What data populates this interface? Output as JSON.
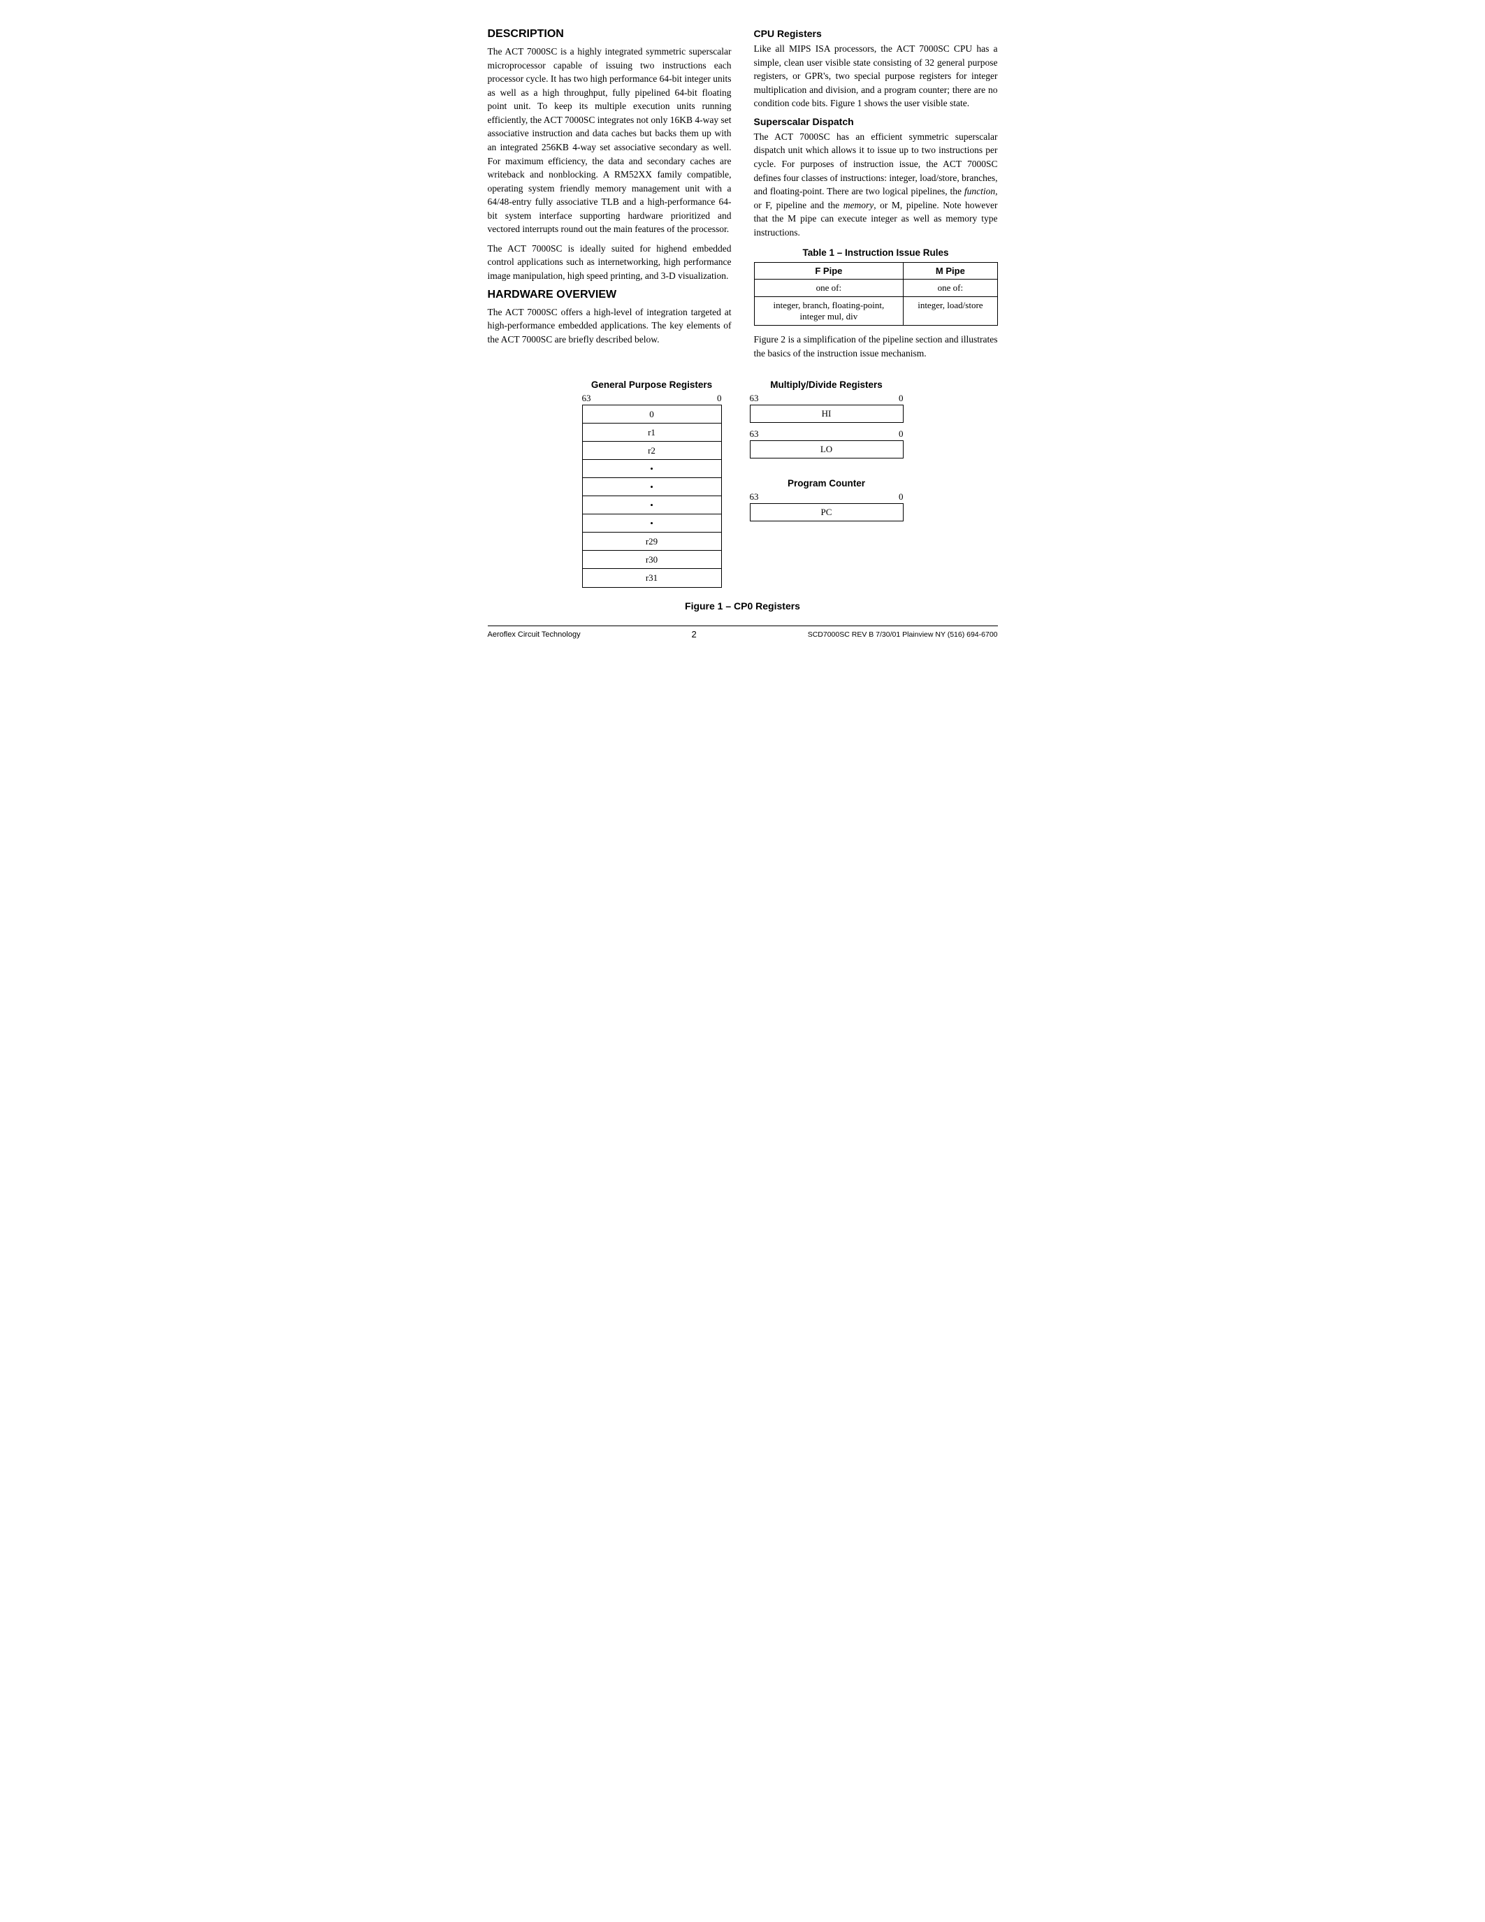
{
  "page": {
    "sections": {
      "description": {
        "heading": "DESCRIPTION",
        "paragraphs": [
          "The ACT 7000SC is a highly integrated symmetric superscalar microprocessor capable of issuing two instructions each processor cycle. It has two high performance 64-bit integer units as well as a high throughput, fully pipelined 64-bit floating point unit. To keep its multiple execution units running efficiently, the ACT 7000SC integrates not only 16KB 4-way set associative instruction and data caches but backs them up with an integrated 256KB 4-way set associative secondary as well. For maximum efficiency, the data and secondary caches are writeback and nonblocking. A RM52XX family compatible, operating system friendly memory management unit with a 64/48-entry fully associative TLB and a high-performance 64-bit system interface supporting hardware prioritized and vectored interrupts round out the main features of the processor.",
          "The ACT 7000SC is ideally suited for highend embedded control applications such as internetworking, high performance image manipulation, high speed printing, and 3-D visualization."
        ]
      },
      "hardware_overview": {
        "heading": "HARDWARE OVERVIEW",
        "paragraphs": [
          "The ACT 7000SC offers a high-level of integration targeted at high-performance embedded applications. The key elements of the ACT 7000SC are briefly described below."
        ]
      },
      "cpu_registers": {
        "heading": "CPU Registers",
        "paragraphs": [
          "Like all MIPS ISA processors, the ACT 7000SC CPU has a simple, clean user visible state consisting of 32 general purpose registers, or GPR's, two special purpose registers for integer multiplication and division, and a program counter; there are no condition code bits. Figure 1 shows the user visible state."
        ]
      },
      "superscalar_dispatch": {
        "heading": "Superscalar Dispatch",
        "paragraphs": [
          "The ACT 7000SC has an efficient symmetric superscalar dispatch unit which allows it to issue up to two instructions per cycle. For purposes of instruction issue, the ACT 7000SC defines four classes of instructions: integer, load/store, branches, and floating-point. There are two logical pipelines, the function, or F, pipeline and the memory, or M, pipeline. Note however that the M pipe can execute integer as well as memory type instructions.",
          "Figure 2 is a simplification of the pipeline section and illustrates the basics of the instruction issue mechanism."
        ]
      },
      "table1": {
        "title": "Table 1 – Instruction Issue Rules",
        "columns": [
          "F Pipe",
          "M Pipe"
        ],
        "rows": [
          [
            "one of:",
            "one of:"
          ],
          [
            "integer, branch, floating-point,\ninteger mul, div",
            "integer, load/store"
          ]
        ]
      }
    },
    "diagrams": {
      "gpr": {
        "title": "General Purpose Registers",
        "range_left": "63",
        "range_right": "0",
        "rows": [
          "0",
          "r1",
          "r2",
          "•",
          "•",
          "•",
          "•",
          "r29",
          "r30",
          "r31"
        ]
      },
      "multiply_divide": {
        "title": "Multiply/Divide Registers",
        "hi": {
          "range_left": "63",
          "range_right": "0",
          "label": "HI"
        },
        "lo": {
          "range_left": "63",
          "range_right": "0",
          "label": "LO"
        }
      },
      "program_counter": {
        "title": "Program Counter",
        "range_left": "63",
        "range_right": "0",
        "label": "PC"
      }
    },
    "figure_caption": "Figure 1 – CP0 Registers",
    "footer": {
      "left": "Aeroflex Circuit Technology",
      "page_number": "2",
      "right": "SCD7000SC REV B  7/30/01  Plainview NY (516) 694-6700"
    }
  }
}
